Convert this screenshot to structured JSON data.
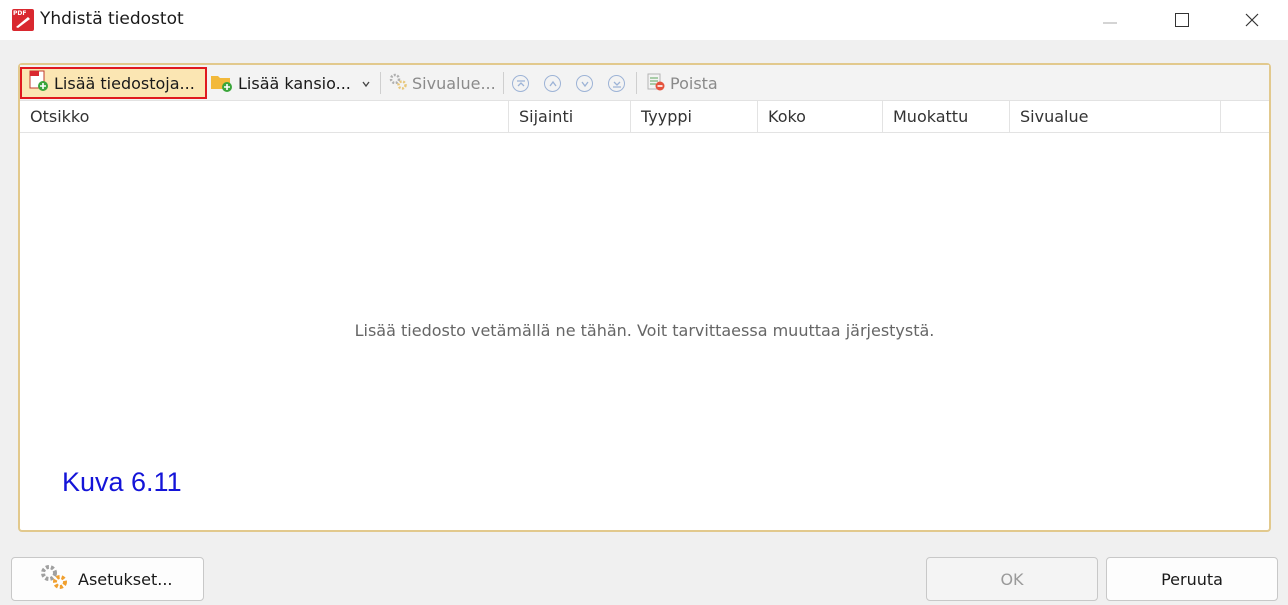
{
  "window": {
    "title": "Yhdistä tiedostot",
    "app_icon_label": "PDF"
  },
  "toolbar": {
    "add_files": "Lisää tiedostoja...",
    "add_folder": "Lisää kansio...",
    "page_range": "Sivualue...",
    "delete": "Poista"
  },
  "table": {
    "columns": [
      "Otsikko",
      "Sijainti",
      "Tyyppi",
      "Koko",
      "Muokattu",
      "Sivualue"
    ],
    "empty_message": "Lisää tiedosto vetämällä ne tähän. Voit tarvittaessa muuttaa järjestystä."
  },
  "figure_label": "Kuva 6.11",
  "buttons": {
    "settings": "Asetukset...",
    "ok": "OK",
    "cancel": "Peruuta"
  },
  "colors": {
    "highlight_border": "#e0191f",
    "figure_label": "#1414d8",
    "panel_border": "#e2c98d"
  }
}
